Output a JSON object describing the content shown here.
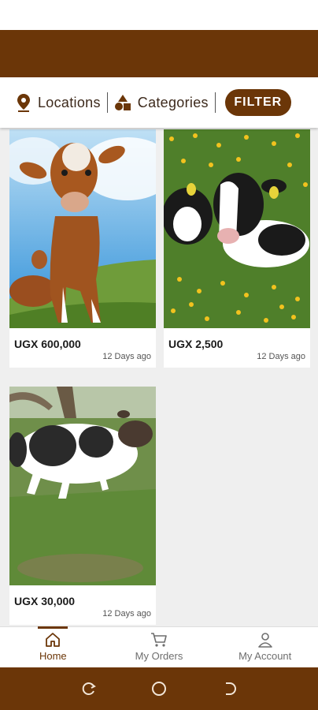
{
  "filter_bar": {
    "locations_label": "Locations",
    "categories_label": "Categories",
    "filter_button": "FILTER"
  },
  "listings": [
    {
      "price": "UGX 600,000",
      "age": "12 Days ago",
      "image": "brown-white-calf-photo"
    },
    {
      "price": "UGX 2,500",
      "age": "12 Days ago",
      "image": "black-white-calves-in-flowers-photo"
    },
    {
      "price": "UGX 30,000",
      "age": "12 Days ago",
      "image": "black-white-cow-on-grass-photo"
    }
  ],
  "bottom_nav": {
    "items": [
      {
        "label": "Home",
        "icon": "home-icon",
        "active": true
      },
      {
        "label": "My Orders",
        "icon": "cart-icon",
        "active": false
      },
      {
        "label": "My Account",
        "icon": "person-icon",
        "active": false
      }
    ]
  },
  "colors": {
    "brand": "#6b3608",
    "text": "#3d2a1c"
  }
}
